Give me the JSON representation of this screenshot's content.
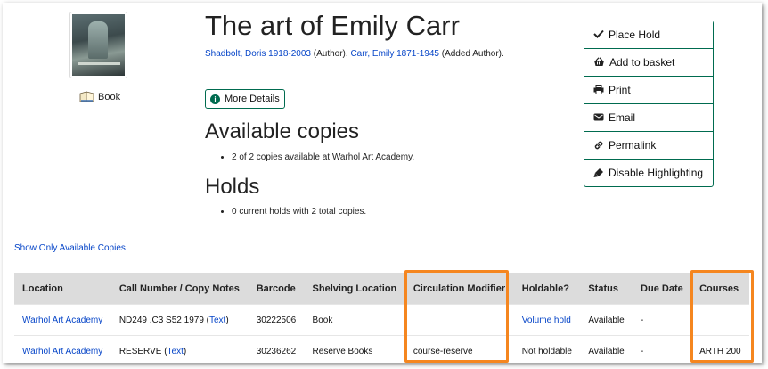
{
  "record": {
    "title": "The art of Emily Carr",
    "format": "Book",
    "authors": [
      {
        "name": "Shadbolt, Doris 1918-2003",
        "role": "(Author)."
      },
      {
        "name": "Carr, Emily 1871-1945",
        "role": "(Added Author)."
      }
    ],
    "more_details_label": "More Details"
  },
  "available_copies": {
    "heading": "Available copies",
    "summary": "2 of 2 copies available at Warhol Art Academy."
  },
  "holds": {
    "heading": "Holds",
    "summary": "0 current holds with 2 total copies."
  },
  "actions": [
    {
      "label": "Place Hold",
      "icon": "check-icon"
    },
    {
      "label": "Add to basket",
      "icon": "basket-icon"
    },
    {
      "label": "Print",
      "icon": "print-icon"
    },
    {
      "label": "Email",
      "icon": "email-icon"
    },
    {
      "label": "Permalink",
      "icon": "link-icon"
    },
    {
      "label": "Disable Highlighting",
      "icon": "highlighter-icon"
    }
  ],
  "show_available_label": "Show Only Available Copies",
  "table": {
    "headers": [
      "Location",
      "Call Number / Copy Notes",
      "Barcode",
      "Shelving Location",
      "Circulation Modifier",
      "Holdable?",
      "Status",
      "Due Date",
      "Courses"
    ],
    "rows": [
      {
        "location": "Warhol Art Academy",
        "call_number": "ND249 .C3 S52 1979",
        "text_link": "Text",
        "barcode": "30222506",
        "shelving": "Book",
        "circ_modifier": "",
        "holdable": "Volume hold",
        "holdable_link": true,
        "status": "Available",
        "due_date": "-",
        "courses": ""
      },
      {
        "location": "Warhol Art Academy",
        "call_number": "RESERVE",
        "text_link": "Text",
        "barcode": "30236262",
        "shelving": "Reserve Books",
        "circ_modifier": "course-reserve",
        "holdable": "Not holdable",
        "holdable_link": false,
        "status": "Available",
        "due_date": "-",
        "courses": "ARTH 200"
      }
    ]
  },
  "colors": {
    "accent": "#006b4f",
    "link": "#0645c8",
    "highlight": "#f5861f",
    "header_bg": "#dcdcdc"
  }
}
